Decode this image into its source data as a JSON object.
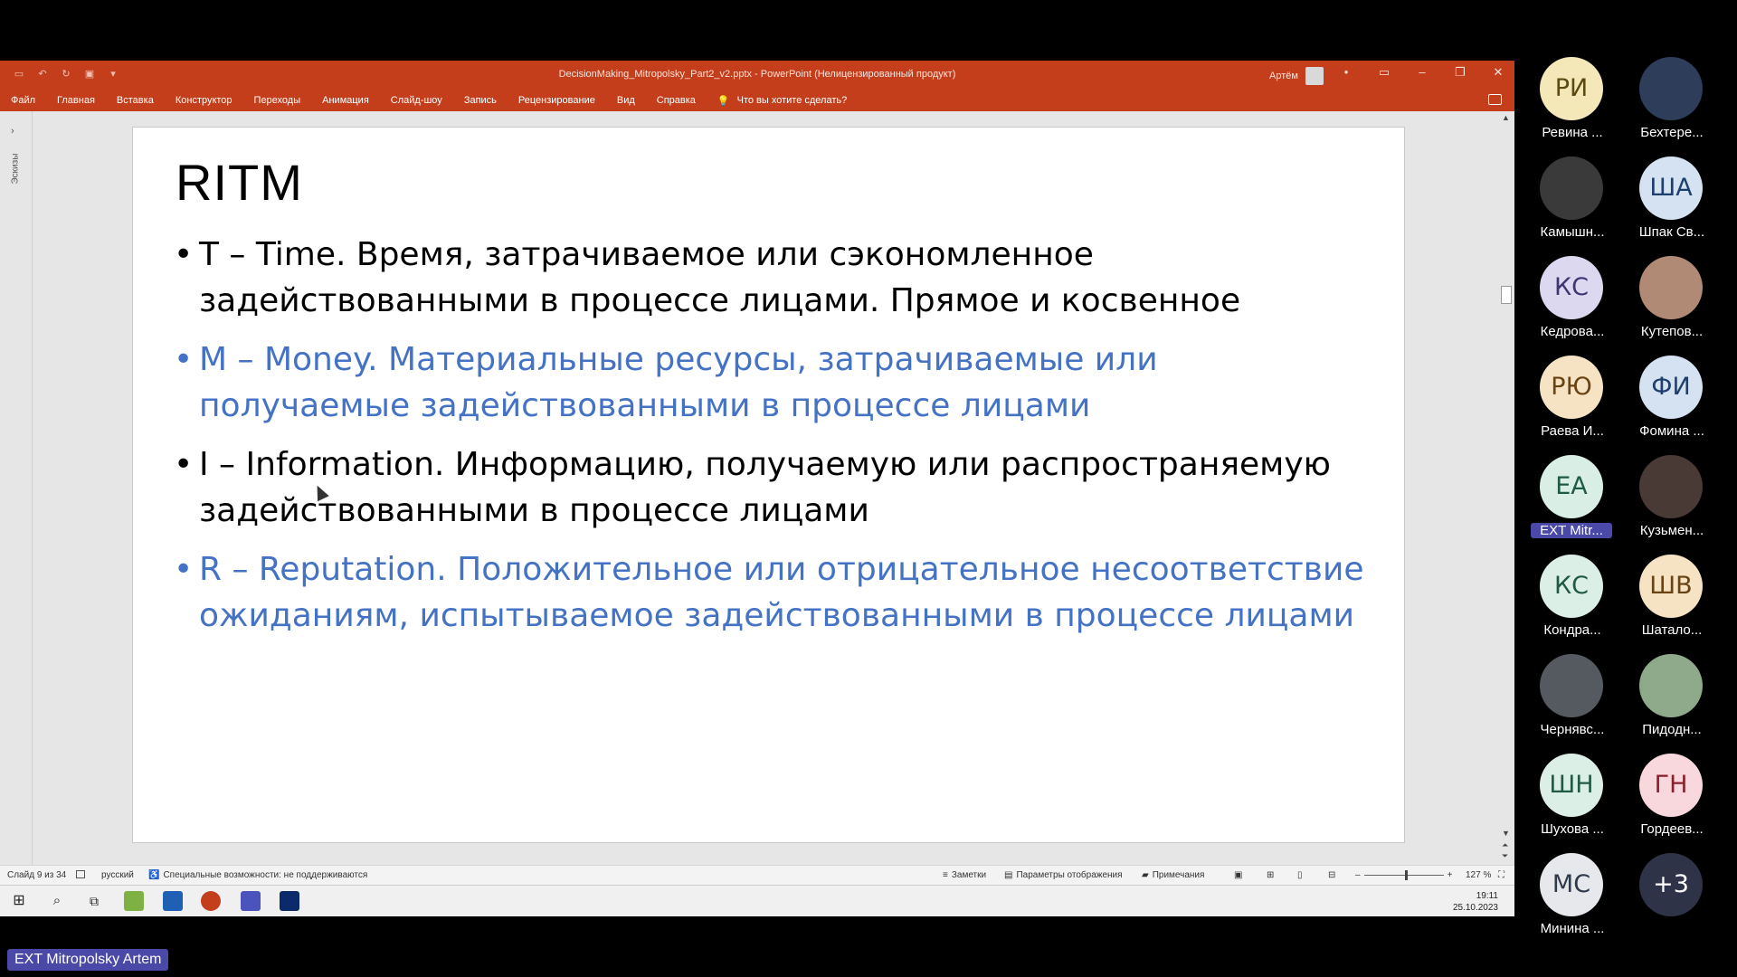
{
  "powerpoint": {
    "doc_title": "DecisionMaking_Mitropolsky_Part2_v2.pptx  -  PowerPoint (Нелицензированный продукт)",
    "user_name": "Артём",
    "menu_tabs": [
      "Файл",
      "Главная",
      "Вставка",
      "Конструктор",
      "Переходы",
      "Анимация",
      "Слайд-шоу",
      "Запись",
      "Рецензирование",
      "Вид",
      "Справка"
    ],
    "tell_me": "Что вы хотите сделать?",
    "thumbs_label": "Эскизы"
  },
  "slide": {
    "title": "RITM",
    "bullets": [
      {
        "text": "T – Time. Время, затрачиваемое или сэкономленное задействованными в процессе лицами. Прямое и косвенное",
        "color": "#000000"
      },
      {
        "text": "M – Money. Материальные ресурсы, затрачиваемые или получаемые задействованными в процессе лицами",
        "color": "#4472c4"
      },
      {
        "text": "I – Information. Информацию, получаемую или распространяемую задействованными в процессе лицами",
        "color": "#000000"
      },
      {
        "text": "R – Reputation. Положительное или отрицательное несоответствие ожиданиям, испытываемое задействованными в процессе лицами",
        "color": "#4472c4"
      }
    ]
  },
  "statusbar": {
    "slide_counter": "Слайд 9 из 34",
    "language": "русский",
    "accessibility": "Специальные возможности: не поддерживаются",
    "notes": "Заметки",
    "display_settings": "Параметры отображения",
    "comments": "Примечания",
    "zoom": "127 %"
  },
  "taskbar": {
    "time": "19:11",
    "date": "25.10.2023"
  },
  "participants": [
    {
      "initials": "РИ",
      "name": "Ревина ...",
      "bg": "#f4e8b8",
      "fg": "#5c4a10"
    },
    {
      "initials": "",
      "name": "Бехтере...",
      "bg": "#2d3d5a",
      "fg": "#ffffff"
    },
    {
      "initials": "",
      "name": "Камышн...",
      "bg": "#3a3a3a",
      "fg": "#ffffff"
    },
    {
      "initials": "ША",
      "name": "Шпак Св...",
      "bg": "#d5e2f2",
      "fg": "#1d3f6e"
    },
    {
      "initials": "КС",
      "name": "Кедрова...",
      "bg": "#dcd8ef",
      "fg": "#3e3672"
    },
    {
      "initials": "",
      "name": "Кутепов...",
      "bg": "#b08a74",
      "fg": "#ffffff"
    },
    {
      "initials": "РЮ",
      "name": "Раева И...",
      "bg": "#f6e3c4",
      "fg": "#6a4312"
    },
    {
      "initials": "ФИ",
      "name": "Фомина ...",
      "bg": "#d5e2f2",
      "fg": "#1d3f6e"
    },
    {
      "initials": "ЕА",
      "name": "EXT Mitr...",
      "bg": "#d9efe6",
      "fg": "#1f5a45",
      "highlight": true
    },
    {
      "initials": "",
      "name": "Кузьмен...",
      "bg": "#4a3a36",
      "fg": "#ffffff"
    },
    {
      "initials": "КС",
      "name": "Кондра...",
      "bg": "#dcefe6",
      "fg": "#1f5a45"
    },
    {
      "initials": "ШВ",
      "name": "Шатало...",
      "bg": "#f6e3c4",
      "fg": "#6a4312"
    },
    {
      "initials": "",
      "name": "Чернявс...",
      "bg": "#555a60",
      "fg": "#ffffff"
    },
    {
      "initials": "",
      "name": "Пидодн...",
      "bg": "#8faa8a",
      "fg": "#ffffff"
    },
    {
      "initials": "ШН",
      "name": "Шухова ...",
      "bg": "#dcefe6",
      "fg": "#1f5a45"
    },
    {
      "initials": "ГН",
      "name": "Гордеев...",
      "bg": "#f8d8dc",
      "fg": "#8a1f2e"
    },
    {
      "initials": "МС",
      "name": "Минина ...",
      "bg": "#e6e8ec",
      "fg": "#2f3a4a"
    },
    {
      "initials": "+3",
      "name": "",
      "bg": "#2f3347",
      "fg": "#ffffff"
    }
  ],
  "presenter_label": "EXT Mitropolsky Artem"
}
